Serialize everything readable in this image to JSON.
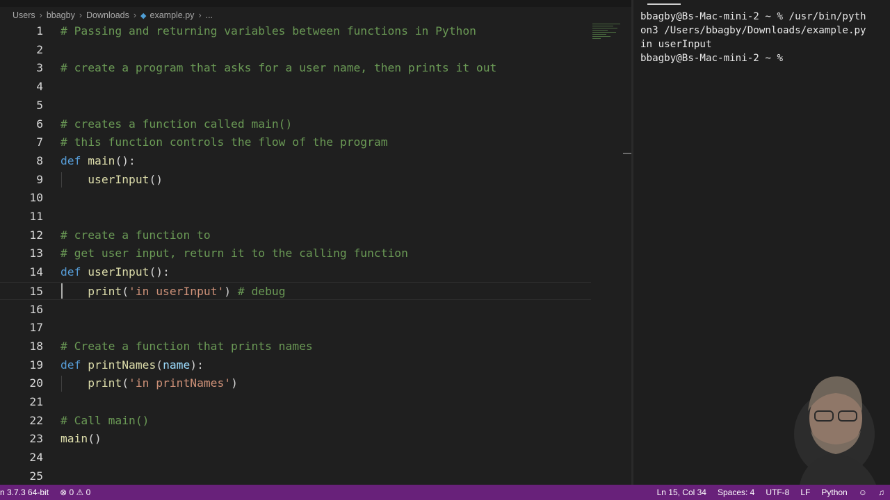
{
  "breadcrumb": {
    "items": [
      "Users",
      "bbagby",
      "Downloads",
      "example.py",
      "..."
    ]
  },
  "editor": {
    "lines": [
      {
        "n": "1",
        "tokens": [
          {
            "c": "c",
            "t": "# Passing and returning variables between functions in Python"
          }
        ]
      },
      {
        "n": "2",
        "tokens": []
      },
      {
        "n": "3",
        "tokens": [
          {
            "c": "c",
            "t": "# create a program that asks for a user name, then prints it out"
          }
        ]
      },
      {
        "n": "4",
        "tokens": []
      },
      {
        "n": "5",
        "tokens": []
      },
      {
        "n": "6",
        "tokens": [
          {
            "c": "c",
            "t": "# creates a function called main()"
          }
        ]
      },
      {
        "n": "7",
        "tokens": [
          {
            "c": "c",
            "t": "# this function controls the flow of the program"
          }
        ]
      },
      {
        "n": "8",
        "tokens": [
          {
            "c": "k",
            "t": "def"
          },
          {
            "c": "",
            "t": " "
          },
          {
            "c": "f",
            "t": "main"
          },
          {
            "c": "",
            "t": "():"
          }
        ]
      },
      {
        "n": "9",
        "tokens": [
          {
            "c": "",
            "t": "    "
          },
          {
            "c": "f",
            "t": "userInput"
          },
          {
            "c": "",
            "t": "()"
          }
        ]
      },
      {
        "n": "10",
        "tokens": []
      },
      {
        "n": "11",
        "tokens": []
      },
      {
        "n": "12",
        "tokens": [
          {
            "c": "c",
            "t": "# create a function to"
          }
        ]
      },
      {
        "n": "13",
        "tokens": [
          {
            "c": "c",
            "t": "# get user input, return it to the calling function"
          }
        ]
      },
      {
        "n": "14",
        "tokens": [
          {
            "c": "k",
            "t": "def"
          },
          {
            "c": "",
            "t": " "
          },
          {
            "c": "f",
            "t": "userInput"
          },
          {
            "c": "",
            "t": "():"
          }
        ]
      },
      {
        "n": "15",
        "tokens": [
          {
            "c": "",
            "t": "    "
          },
          {
            "c": "f",
            "t": "print"
          },
          {
            "c": "",
            "t": "("
          },
          {
            "c": "s",
            "t": "'in userInput'"
          },
          {
            "c": "",
            "t": ") "
          },
          {
            "c": "c",
            "t": "# debug"
          }
        ]
      },
      {
        "n": "16",
        "tokens": []
      },
      {
        "n": "17",
        "tokens": []
      },
      {
        "n": "18",
        "tokens": [
          {
            "c": "c",
            "t": "# Create a function that prints names"
          }
        ]
      },
      {
        "n": "19",
        "tokens": [
          {
            "c": "k",
            "t": "def"
          },
          {
            "c": "",
            "t": " "
          },
          {
            "c": "f",
            "t": "printNames"
          },
          {
            "c": "",
            "t": "("
          },
          {
            "c": "p",
            "t": "name"
          },
          {
            "c": "",
            "t": "):"
          }
        ]
      },
      {
        "n": "20",
        "tokens": [
          {
            "c": "",
            "t": "    "
          },
          {
            "c": "f",
            "t": "print"
          },
          {
            "c": "",
            "t": "("
          },
          {
            "c": "s",
            "t": "'in printNames'"
          },
          {
            "c": "",
            "t": ")"
          }
        ]
      },
      {
        "n": "21",
        "tokens": []
      },
      {
        "n": "22",
        "tokens": [
          {
            "c": "c",
            "t": "# Call main()"
          }
        ]
      },
      {
        "n": "23",
        "tokens": [
          {
            "c": "f",
            "t": "main"
          },
          {
            "c": "",
            "t": "()"
          }
        ]
      },
      {
        "n": "24",
        "tokens": []
      },
      {
        "n": "25",
        "tokens": []
      }
    ]
  },
  "terminal": {
    "lines": [
      "bbagby@Bs-Mac-mini-2 ~ % /usr/bin/pyth",
      "on3 /Users/bbagby/Downloads/example.py",
      "in userInput",
      "bbagby@Bs-Mac-mini-2 ~ % "
    ]
  },
  "statusbar": {
    "python_version": "n 3.7.3 64-bit",
    "errors": "0",
    "warnings": "0",
    "cursor_position": "Ln 15, Col 34",
    "indentation": "Spaces: 4",
    "encoding": "UTF-8",
    "eol": "LF",
    "language": "Python"
  },
  "colors": {
    "statusbar_bg": "#68217a",
    "editor_bg": "#1f1f1f",
    "comment": "#6a9955",
    "keyword": "#569cd6",
    "function": "#dcdcaa",
    "string": "#ce9178",
    "parameter": "#9cdcfe"
  }
}
